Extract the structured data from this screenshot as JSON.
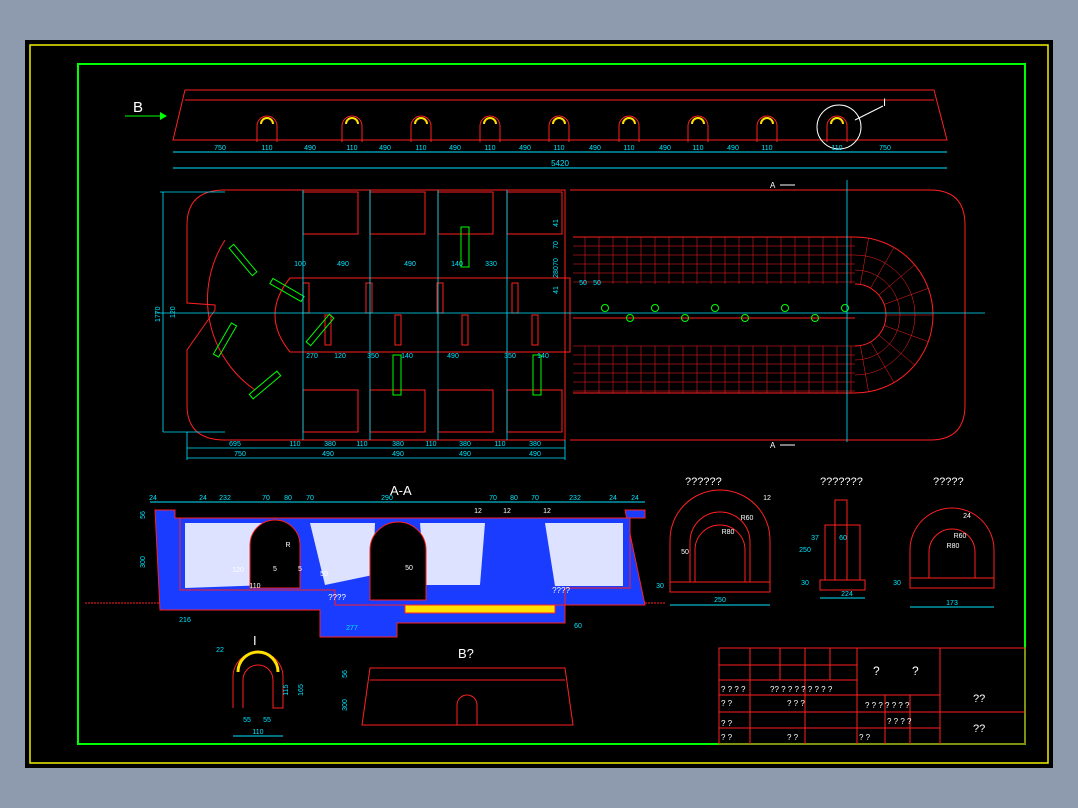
{
  "colors": {
    "frame_yellow": "#f0f000",
    "frame_green": "#00ff00",
    "line_red": "#ff2020",
    "dim_cyan": "#00e5ff",
    "label_white": "#ffffff",
    "hatch_blue": "#1a3cff",
    "heater_yellow": "#ffe000"
  },
  "views": {
    "top": {
      "view_mark": "B",
      "dims_small": [
        "110",
        "110",
        "110",
        "110",
        "110",
        "110",
        "110",
        "110",
        "110"
      ],
      "dims_spacing": [
        "750",
        "490",
        "490",
        "490",
        "490",
        "490",
        "490",
        "490",
        "750"
      ],
      "total": "5420",
      "detail_mark": "I"
    },
    "plan": {
      "section_mark_top": "A",
      "section_mark_bottom": "A",
      "left_height": "1770",
      "left_small": "120",
      "row1": [
        "100",
        "490",
        "490",
        "140",
        "330"
      ],
      "row2": [
        "270",
        "120",
        "350",
        "140",
        "490",
        "350",
        "140"
      ],
      "right_vert": [
        "41",
        "70",
        "70",
        "280",
        "41"
      ],
      "right_horiz": [
        "50",
        "50"
      ],
      "bottom1": [
        "695",
        "110",
        "380",
        "110",
        "380",
        "110",
        "380",
        "110",
        "380"
      ],
      "bottom2": [
        "750",
        "490",
        "490",
        "490",
        "490"
      ]
    },
    "section": {
      "title": "A-A",
      "top_dims": [
        "24",
        "24",
        "232",
        "70",
        "80",
        "70",
        "290",
        "70",
        "80",
        "70",
        "232",
        "24",
        "24"
      ],
      "left_dims": [
        "56",
        "300"
      ],
      "inner_dims": [
        "120",
        "R",
        "5",
        "5",
        "110",
        "50",
        "50",
        "12",
        "12",
        "12"
      ],
      "labels": [
        "????",
        "????"
      ],
      "bottom_dims": [
        "216",
        "277",
        "60"
      ]
    },
    "detail_a": {
      "title": "??????",
      "dims": [
        "50",
        "R80",
        "R60",
        "12",
        "30",
        "250"
      ]
    },
    "detail_b": {
      "title": "???????",
      "dims": [
        "37",
        "60",
        "250",
        "30",
        "224"
      ]
    },
    "detail_c": {
      "title": "?????",
      "dims": [
        "R80",
        "R60",
        "24",
        "30",
        "173"
      ]
    },
    "detail_i": {
      "title": "I",
      "dims": [
        "22",
        "115",
        "165",
        "55",
        "55",
        "110"
      ]
    },
    "view_b": {
      "title": "B?",
      "dims": [
        "56",
        "300"
      ]
    }
  },
  "title_block": {
    "center_labels": [
      "?",
      "?"
    ],
    "row_labels": [
      "? ? ? ?",
      "?? ? ? ? ? ? ? ? ?",
      "? ? ?",
      "? ?",
      "? ?",
      "? ?",
      "? ?",
      "? ?"
    ],
    "mid_labels": [
      "? ? ? ? ? ? ?",
      "? ? ? ?"
    ],
    "right_top": "??",
    "right_bottom": "??"
  }
}
